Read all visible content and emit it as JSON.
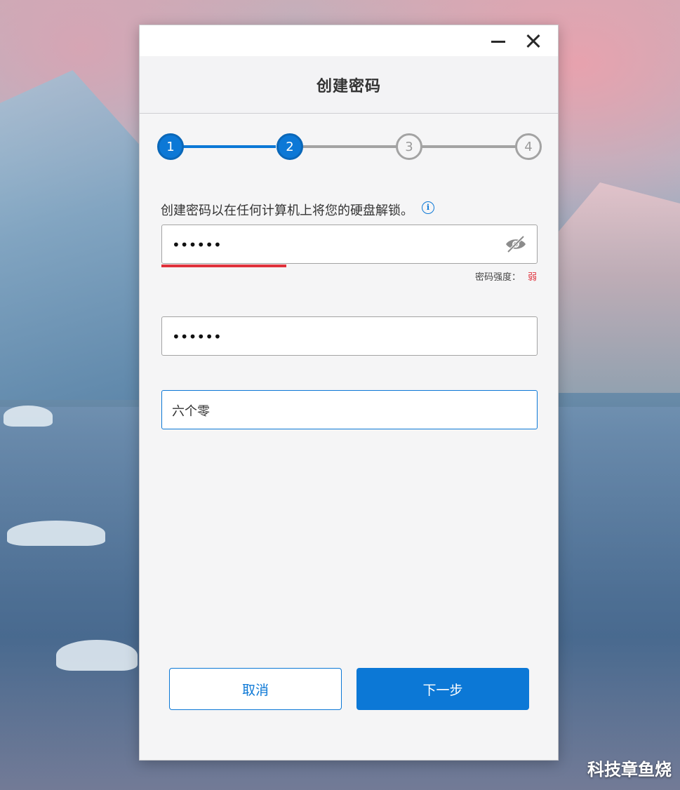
{
  "dialog": {
    "title": "创建密码",
    "steps": [
      "1",
      "2",
      "3",
      "4"
    ],
    "active_steps": 2,
    "prompt": "创建密码以在任何计算机上将您的硬盘解锁。",
    "password": {
      "value": "••••••"
    },
    "strength": {
      "label": "密码强度：",
      "value": "弱",
      "level": 0.33
    },
    "confirm_password": {
      "value": "••••••"
    },
    "hint": {
      "value": "六个零"
    },
    "buttons": {
      "cancel": "取消",
      "next": "下一步"
    }
  },
  "watermark": "科技章鱼烧",
  "colors": {
    "accent": "#0c78d6",
    "weak": "#e0323c",
    "inactive": "#a3a3a3"
  },
  "icons": {
    "minimize": "minimize-icon",
    "close": "close-icon",
    "info": "info-icon",
    "eye": "eye-slash-icon"
  }
}
